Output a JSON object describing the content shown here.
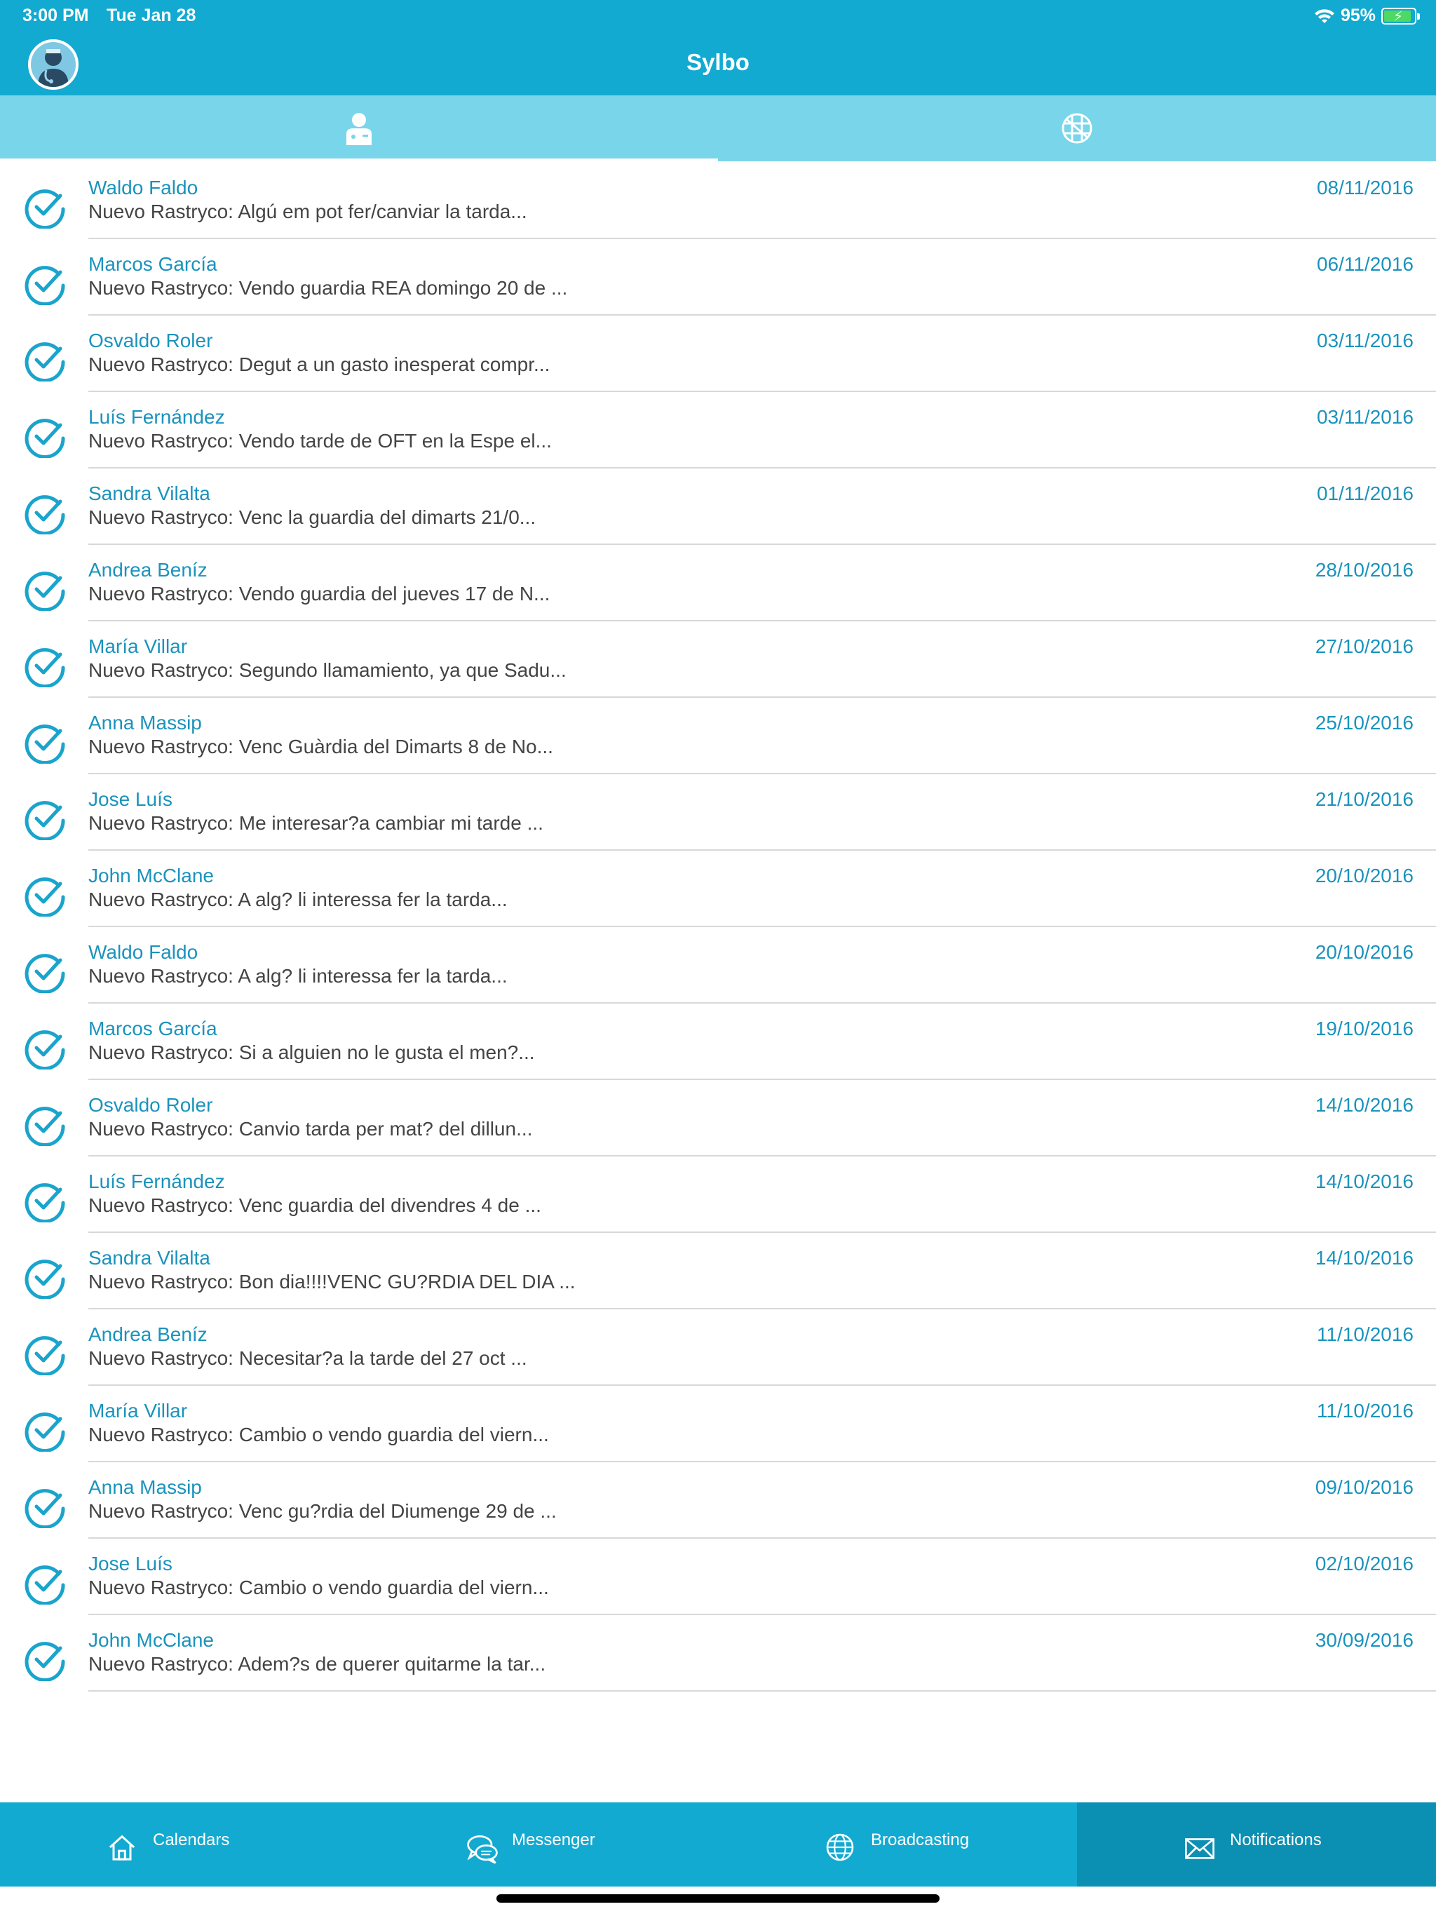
{
  "status_bar": {
    "time": "3:00 PM",
    "date": "Tue Jan 28",
    "battery": "95%",
    "battery_level": 0.95
  },
  "header": {
    "title": "Sylbo"
  },
  "top_tabs": [
    {
      "icon": "doctor-icon",
      "active": true
    },
    {
      "icon": "globe-grid-icon",
      "active": false
    }
  ],
  "notifications": [
    {
      "name": "Waldo Faldo",
      "message": "Nuevo Rastryco: Algú em pot fer/canviar la tarda...",
      "date": "08/11/2016"
    },
    {
      "name": "Marcos García",
      "message": "Nuevo Rastryco: Vendo guardia REA domingo 20 de ...",
      "date": "06/11/2016"
    },
    {
      "name": "Osvaldo Roler",
      "message": "Nuevo Rastryco: Degut a un gasto inesperat compr...",
      "date": "03/11/2016"
    },
    {
      "name": "Luís Fernández",
      "message": "Nuevo Rastryco: Vendo tarde de OFT en la Espe el...",
      "date": "03/11/2016"
    },
    {
      "name": "Sandra Vilalta",
      "message": "Nuevo Rastryco: Venc la guardia del dimarts 21/0...",
      "date": "01/11/2016"
    },
    {
      "name": "Andrea Beníz",
      "message": "Nuevo Rastryco: Vendo guardia del jueves 17 de N...",
      "date": "28/10/2016"
    },
    {
      "name": "María Villar",
      "message": "Nuevo Rastryco: Segundo llamamiento, ya que Sadu...",
      "date": "27/10/2016"
    },
    {
      "name": "Anna Massip",
      "message": "Nuevo Rastryco: Venc Guàrdia del Dimarts 8 de No...",
      "date": "25/10/2016"
    },
    {
      "name": "Jose Luís",
      "message": "Nuevo Rastryco: Me interesar?a cambiar mi tarde ...",
      "date": "21/10/2016"
    },
    {
      "name": "John McClane",
      "message": "Nuevo Rastryco: A alg? li interessa fer la tarda...",
      "date": "20/10/2016"
    },
    {
      "name": "Waldo Faldo",
      "message": "Nuevo Rastryco: A alg? li interessa fer la tarda...",
      "date": "20/10/2016"
    },
    {
      "name": "Marcos García",
      "message": "Nuevo Rastryco: Si a alguien no le gusta el men?...",
      "date": "19/10/2016"
    },
    {
      "name": "Osvaldo Roler",
      "message": "Nuevo Rastryco: Canvio tarda per mat? del dillun...",
      "date": "14/10/2016"
    },
    {
      "name": "Luís Fernández",
      "message": "Nuevo Rastryco: Venc guardia del divendres 4 de ...",
      "date": "14/10/2016"
    },
    {
      "name": "Sandra Vilalta",
      "message": "Nuevo Rastryco: Bon dia!!!!VENC GU?RDIA DEL DIA ...",
      "date": "14/10/2016"
    },
    {
      "name": "Andrea Beníz",
      "message": "Nuevo Rastryco: Necesitar?a la tarde del 27 oct ...",
      "date": "11/10/2016"
    },
    {
      "name": "María Villar",
      "message": "Nuevo Rastryco: Cambio o vendo guardia del viern...",
      "date": "11/10/2016"
    },
    {
      "name": "Anna Massip",
      "message": "Nuevo Rastryco: Venc gu?rdia del Diumenge 29 de ...",
      "date": "09/10/2016"
    },
    {
      "name": "Jose Luís",
      "message": "Nuevo Rastryco: Cambio o vendo guardia del viern...",
      "date": "02/10/2016"
    },
    {
      "name": "John McClane",
      "message": "Nuevo Rastryco: Adem?s de querer quitarme la tar...",
      "date": "30/09/2016"
    }
  ],
  "bottom_tabs": [
    {
      "label": "Calendars",
      "icon": "home-icon",
      "active": false
    },
    {
      "label": "Messenger",
      "icon": "chat-bubbles-icon",
      "active": false
    },
    {
      "label": "Broadcasting",
      "icon": "globe-icon",
      "active": false
    },
    {
      "label": "Notifications",
      "icon": "envelope-icon",
      "active": true
    }
  ],
  "colors": {
    "primary": "#12aad1",
    "tab_strip": "#79d5e9",
    "accent_text": "#1a93bd",
    "active_bottom": "#0b8fb3"
  }
}
